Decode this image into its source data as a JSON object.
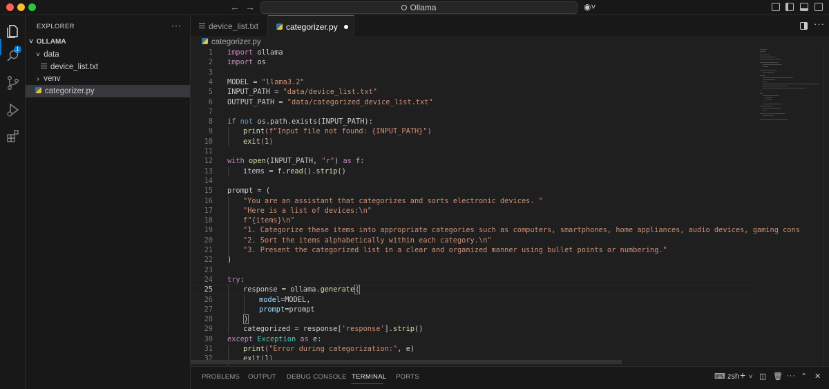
{
  "window": {
    "title": "Ollama"
  },
  "explorer": {
    "header": "EXPLORER",
    "more": "···",
    "root": "OLLAMA",
    "items": [
      {
        "label": "data",
        "kind": "folder",
        "expanded": true
      },
      {
        "label": "device_list.txt",
        "kind": "file-txt"
      },
      {
        "label": "venv",
        "kind": "folder",
        "expanded": false
      },
      {
        "label": "categorizer.py",
        "kind": "file-py",
        "selected": true
      }
    ]
  },
  "activity": {
    "explorer_badge": "1"
  },
  "tabs": [
    {
      "label": "device_list.txt",
      "active": false
    },
    {
      "label": "categorizer.py",
      "active": true,
      "modified": true
    }
  ],
  "breadcrumb": "categorizer.py",
  "editor": {
    "line_numbers": [
      "1",
      "2",
      "3",
      "4",
      "5",
      "6",
      "7",
      "8",
      "9",
      "10",
      "11",
      "12",
      "13",
      "14",
      "15",
      "16",
      "17",
      "18",
      "19",
      "20",
      "21",
      "22",
      "23",
      "24",
      "25",
      "26",
      "27",
      "28",
      "29",
      "30",
      "31",
      "32"
    ],
    "current_line": "25",
    "code": {
      "l1": [
        "import",
        " ollama"
      ],
      "l2": [
        "import",
        " os"
      ],
      "l4": [
        "MODEL = ",
        "\"llama3.2\""
      ],
      "l5": [
        "INPUT_PATH = ",
        "\"data/device_list.txt\""
      ],
      "l6": [
        "OUTPUT_PATH = ",
        "\"data/categorized_device_list.txt\""
      ],
      "l8": [
        "if",
        " ",
        "not",
        " os.path.exists(INPUT_PATH):"
      ],
      "l9": [
        "print",
        "(",
        "f\"Input file not found: {INPUT_PATH}\"",
        ")"
      ],
      "l10": [
        "exit",
        "(",
        "1",
        ")"
      ],
      "l12": [
        "with",
        " ",
        "open",
        "(INPUT_PATH, ",
        "\"r\"",
        ") ",
        "as",
        " f:"
      ],
      "l13": [
        "items = f.",
        "read",
        "().",
        "strip",
        "()"
      ],
      "l15": [
        "prompt = ("
      ],
      "l16": [
        "\"You are an assistant that categorizes and sorts electronic devices. \""
      ],
      "l17": [
        "\"Here is a list of devices:\\n\""
      ],
      "l18": [
        "f\"{items}\\n\""
      ],
      "l19": [
        "\"1. Categorize these items into appropriate categories such as computers, smartphones, home appliances, audio devices, gaming cons"
      ],
      "l20": [
        "\"2. Sort the items alphabetically within each category.\\n\""
      ],
      "l21": [
        "\"3. Present the categorized list in a clear and organized manner using bullet points or numbering.\""
      ],
      "l22": [
        ")"
      ],
      "l24": [
        "try",
        ":"
      ],
      "l25": [
        "response = ollama.",
        "generate",
        "("
      ],
      "l26": [
        "model",
        "=MODEL,"
      ],
      "l27": [
        "prompt",
        "=prompt"
      ],
      "l28": [
        ")"
      ],
      "l29": [
        "categorized = response[",
        "'response'",
        "].",
        "strip",
        "()"
      ],
      "l30": [
        "except",
        " ",
        "Exception",
        " ",
        "as",
        " e:"
      ],
      "l31": [
        "print",
        "(",
        "\"Error during categorization:\"",
        ", e)"
      ],
      "l32": [
        "exit",
        "(",
        "1",
        ")"
      ]
    }
  },
  "panel": {
    "tabs": [
      "PROBLEMS",
      "OUTPUT",
      "DEBUG CONSOLE",
      "TERMINAL",
      "PORTS"
    ],
    "active_tab": "TERMINAL",
    "terminal_name": "zsh",
    "add": "+",
    "more": "···"
  },
  "colors": {
    "accent": "#0078d4",
    "keyword": "#c586c0",
    "string": "#ce9178",
    "function": "#dcdcaa",
    "variable": "#9cdcfe",
    "number": "#b5cea8",
    "class": "#4ec9b0"
  }
}
